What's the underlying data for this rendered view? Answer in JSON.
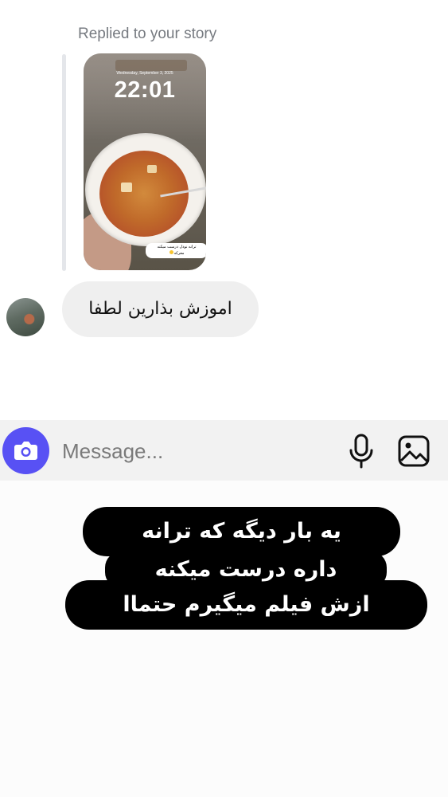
{
  "thread": {
    "replied_label": "Replied to your story",
    "story": {
      "lock_date": "Wednesday, September 3, 2025",
      "lock_time": "22:01",
      "caption_line1": "ترانه نودل درست میکنه",
      "caption_line2": "معرکه"
    },
    "message_text": "اموزش بذارین لطفا"
  },
  "composer": {
    "placeholder": "Message...",
    "camera_icon": "camera-icon",
    "mic_icon": "microphone-icon",
    "gallery_icon": "gallery-icon",
    "accent_color": "#5851f4"
  },
  "overlay": {
    "line1": "یه بار دیگه که ترانه",
    "line2": "داره درست میکنه",
    "line3": "ازش فیلم میگیرم حتماا"
  }
}
